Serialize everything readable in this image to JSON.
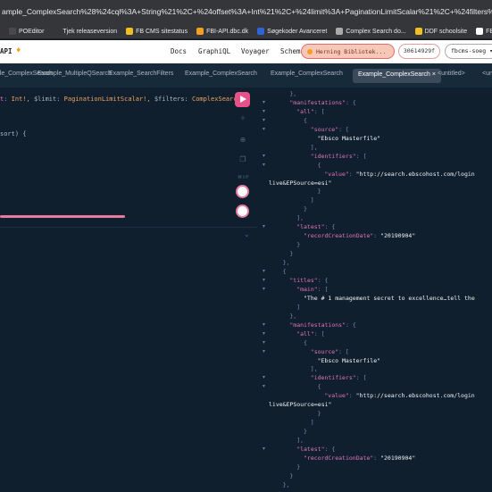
{
  "browser": {
    "url": "ample_ComplexSearch%28%24cql%3A+String%21%2C+%24offset%3A+Int%21%2C+%24limit%3A+PaginationLimitScalar%21%2C+%24filters%3A+ComplexSearc",
    "bookmarks": [
      {
        "label": "POEditor",
        "icon": "poeditor-icon",
        "color": "#4a4a4a"
      },
      {
        "label": "Tjek releaseversion",
        "icon": "blank-icon",
        "color": "#35363a"
      },
      {
        "label": "FB CMS sitestatus",
        "icon": "bolt-icon",
        "color": "#f0c020"
      },
      {
        "label": "FBI-API.dbc.dk",
        "icon": "fbi-icon",
        "color": "#f0a023"
      },
      {
        "label": "Søgekoder Avanceret",
        "icon": "dbc-icon",
        "color": "#2f64d8"
      },
      {
        "label": "Complex Search do...",
        "icon": "globe-icon",
        "color": "#aaaaaa"
      },
      {
        "label": "DDF schoolsite",
        "icon": "ddf-icon",
        "color": "#f0c020"
      },
      {
        "label": "FB CMS GitHub",
        "icon": "github-icon",
        "color": "#ffffff"
      }
    ]
  },
  "app": {
    "title": "API",
    "nav": [
      "Docs",
      "GraphiQL",
      "Voyager",
      "Schema"
    ],
    "profile": "Herning Bibliotek...",
    "agency_id": "30614929f",
    "select": "fbcms-soeg"
  },
  "tabs": [
    {
      "label": "Example_ComplexSearch",
      "active": false
    },
    {
      "label": "Example_MultipleQSearch",
      "active": false
    },
    {
      "label": "Example_SearchFilters",
      "active": false
    },
    {
      "label": "Example_ComplexSearch",
      "active": false
    },
    {
      "label": "Example_ComplexSearch",
      "active": false
    },
    {
      "label": "Example_ComplexSearch",
      "active": true
    },
    {
      "label": "<untitled>",
      "active": false
    },
    {
      "label": "<un",
      "active": false
    }
  ],
  "editor": {
    "line1_sep": "t:",
    "line1_int": "Int!",
    "line1_var": ", $limit:",
    "line1_type": "PaginationLimitScalar!,",
    "line1_var2": "$filters:",
    "line1_type2": "ComplexSearc",
    "line2": "sort) {",
    "prettify_label": "⌘⇧P"
  },
  "results": [
    {
      "t": "},",
      "indent": 6,
      "fold": false
    },
    {
      "k": "\"manifestations\"",
      "rest": ": {",
      "indent": 6,
      "fold": true
    },
    {
      "k": "\"all\"",
      "rest": ": [",
      "indent": 8,
      "fold": true
    },
    {
      "t": "{",
      "indent": 10,
      "fold": true
    },
    {
      "k": "\"source\"",
      "rest": ": [",
      "indent": 12,
      "fold": true
    },
    {
      "s": "\"Ebsco Masterfile\"",
      "indent": 14,
      "fold": false
    },
    {
      "t": "],",
      "indent": 12,
      "fold": false
    },
    {
      "k": "\"identifiers\"",
      "rest": ": [",
      "indent": 12,
      "fold": true
    },
    {
      "t": "{",
      "indent": 14,
      "fold": true
    },
    {
      "k": "\"value\"",
      "rest": ": ",
      "s2": "\"http://search.ebscohost.com/login",
      "indent": 16,
      "fold": false
    },
    {
      "s": "live&EPSource=esi\"",
      "indent": 0,
      "fold": false
    },
    {
      "t": "}",
      "indent": 14,
      "fold": false
    },
    {
      "t": "]",
      "indent": 12,
      "fold": false
    },
    {
      "t": "}",
      "indent": 10,
      "fold": false
    },
    {
      "t": "],",
      "indent": 8,
      "fold": false
    },
    {
      "k": "\"latest\"",
      "rest": ": {",
      "indent": 8,
      "fold": true
    },
    {
      "k": "\"recordCreationDate\"",
      "rest": ": ",
      "s2": "\"20190904\"",
      "indent": 10,
      "fold": false
    },
    {
      "t": "}",
      "indent": 8,
      "fold": false
    },
    {
      "t": "}",
      "indent": 6,
      "fold": false
    },
    {
      "t": "},",
      "indent": 4,
      "fold": false
    },
    {
      "t": "{",
      "indent": 4,
      "fold": true
    },
    {
      "k": "\"titles\"",
      "rest": ": {",
      "indent": 6,
      "fold": true
    },
    {
      "k": "\"main\"",
      "rest": ": [",
      "indent": 8,
      "fold": true
    },
    {
      "s": "\"The # 1 management secret to excellence…tell the",
      "indent": 10,
      "fold": false
    },
    {
      "t": "]",
      "indent": 8,
      "fold": false
    },
    {
      "t": "},",
      "indent": 6,
      "fold": false
    },
    {
      "k": "\"manifestations\"",
      "rest": ": {",
      "indent": 6,
      "fold": true
    },
    {
      "k": "\"all\"",
      "rest": ": [",
      "indent": 8,
      "fold": true
    },
    {
      "t": "{",
      "indent": 10,
      "fold": true
    },
    {
      "k": "\"source\"",
      "rest": ": [",
      "indent": 12,
      "fold": true
    },
    {
      "s": "\"Ebsco Masterfile\"",
      "indent": 14,
      "fold": false
    },
    {
      "t": "],",
      "indent": 12,
      "fold": false
    },
    {
      "k": "\"identifiers\"",
      "rest": ": [",
      "indent": 12,
      "fold": true
    },
    {
      "t": "{",
      "indent": 14,
      "fold": true
    },
    {
      "k": "\"value\"",
      "rest": ": ",
      "s2": "\"http://search.ebscohost.com/login",
      "indent": 16,
      "fold": false
    },
    {
      "s": "live&EPSource=esi\"",
      "indent": 0,
      "fold": false
    },
    {
      "t": "}",
      "indent": 14,
      "fold": false
    },
    {
      "t": "]",
      "indent": 12,
      "fold": false
    },
    {
      "t": "}",
      "indent": 10,
      "fold": false
    },
    {
      "t": "],",
      "indent": 8,
      "fold": false
    },
    {
      "k": "\"latest\"",
      "rest": ": {",
      "indent": 8,
      "fold": true
    },
    {
      "k": "\"recordCreationDate\"",
      "rest": ": ",
      "s2": "\"20190904\"",
      "indent": 10,
      "fold": false
    },
    {
      "t": "}",
      "indent": 8,
      "fold": false
    },
    {
      "t": "}",
      "indent": 6,
      "fold": false
    },
    {
      "t": "},",
      "indent": 4,
      "fold": false
    }
  ]
}
